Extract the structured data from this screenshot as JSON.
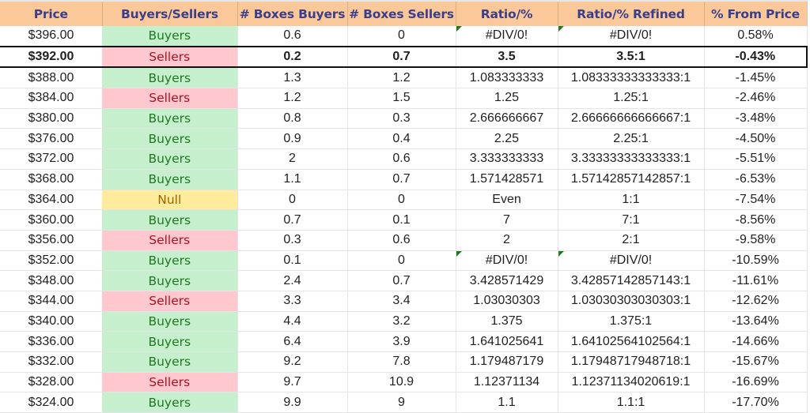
{
  "table": {
    "headers": [
      "Price",
      "Buyers/Sellers",
      "# Boxes Buyers",
      "# Boxes Sellers",
      "Ratio/%",
      "Ratio/% Refined",
      "% From Price"
    ],
    "rows": [
      {
        "price": "$396.00",
        "side": "Buyers",
        "boxes_buyers": "0.6",
        "boxes_sellers": "0",
        "ratio": "#DIV/0!",
        "ratio_refined": "#DIV/0!",
        "pct_from_price": "0.58%",
        "error_flag": true,
        "current": false
      },
      {
        "price": "$392.00",
        "side": "Sellers",
        "boxes_buyers": "0.2",
        "boxes_sellers": "0.7",
        "ratio": "3.5",
        "ratio_refined": "3.5:1",
        "pct_from_price": "-0.43%",
        "error_flag": false,
        "current": true
      },
      {
        "price": "$388.00",
        "side": "Buyers",
        "boxes_buyers": "1.3",
        "boxes_sellers": "1.2",
        "ratio": "1.083333333",
        "ratio_refined": "1.08333333333333:1",
        "pct_from_price": "-1.45%",
        "error_flag": false,
        "current": false
      },
      {
        "price": "$384.00",
        "side": "Sellers",
        "boxes_buyers": "1.2",
        "boxes_sellers": "1.5",
        "ratio": "1.25",
        "ratio_refined": "1.25:1",
        "pct_from_price": "-2.46%",
        "error_flag": false,
        "current": false
      },
      {
        "price": "$380.00",
        "side": "Buyers",
        "boxes_buyers": "0.8",
        "boxes_sellers": "0.3",
        "ratio": "2.666666667",
        "ratio_refined": "2.66666666666667:1",
        "pct_from_price": "-3.48%",
        "error_flag": false,
        "current": false
      },
      {
        "price": "$376.00",
        "side": "Buyers",
        "boxes_buyers": "0.9",
        "boxes_sellers": "0.4",
        "ratio": "2.25",
        "ratio_refined": "2.25:1",
        "pct_from_price": "-4.50%",
        "error_flag": false,
        "current": false
      },
      {
        "price": "$372.00",
        "side": "Buyers",
        "boxes_buyers": "2",
        "boxes_sellers": "0.6",
        "ratio": "3.333333333",
        "ratio_refined": "3.33333333333333:1",
        "pct_from_price": "-5.51%",
        "error_flag": false,
        "current": false
      },
      {
        "price": "$368.00",
        "side": "Buyers",
        "boxes_buyers": "1.1",
        "boxes_sellers": "0.7",
        "ratio": "1.571428571",
        "ratio_refined": "1.57142857142857:1",
        "pct_from_price": "-6.53%",
        "error_flag": false,
        "current": false
      },
      {
        "price": "$364.00",
        "side": "Null",
        "boxes_buyers": "0",
        "boxes_sellers": "0",
        "ratio": "Even",
        "ratio_refined": "1:1",
        "pct_from_price": "-7.54%",
        "error_flag": false,
        "current": false
      },
      {
        "price": "$360.00",
        "side": "Buyers",
        "boxes_buyers": "0.7",
        "boxes_sellers": "0.1",
        "ratio": "7",
        "ratio_refined": "7:1",
        "pct_from_price": "-8.56%",
        "error_flag": false,
        "current": false
      },
      {
        "price": "$356.00",
        "side": "Sellers",
        "boxes_buyers": "0.3",
        "boxes_sellers": "0.6",
        "ratio": "2",
        "ratio_refined": "2:1",
        "pct_from_price": "-9.58%",
        "error_flag": false,
        "current": false
      },
      {
        "price": "$352.00",
        "side": "Buyers",
        "boxes_buyers": "0.1",
        "boxes_sellers": "0",
        "ratio": "#DIV/0!",
        "ratio_refined": "#DIV/0!",
        "pct_from_price": "-10.59%",
        "error_flag": true,
        "current": false
      },
      {
        "price": "$348.00",
        "side": "Buyers",
        "boxes_buyers": "2.4",
        "boxes_sellers": "0.7",
        "ratio": "3.428571429",
        "ratio_refined": "3.42857142857143:1",
        "pct_from_price": "-11.61%",
        "error_flag": false,
        "current": false
      },
      {
        "price": "$344.00",
        "side": "Sellers",
        "boxes_buyers": "3.3",
        "boxes_sellers": "3.4",
        "ratio": "1.03030303",
        "ratio_refined": "1.03030303030303:1",
        "pct_from_price": "-12.62%",
        "error_flag": false,
        "current": false
      },
      {
        "price": "$340.00",
        "side": "Buyers",
        "boxes_buyers": "4.4",
        "boxes_sellers": "3.2",
        "ratio": "1.375",
        "ratio_refined": "1.375:1",
        "pct_from_price": "-13.64%",
        "error_flag": false,
        "current": false
      },
      {
        "price": "$336.00",
        "side": "Buyers",
        "boxes_buyers": "6.4",
        "boxes_sellers": "3.9",
        "ratio": "1.641025641",
        "ratio_refined": "1.64102564102564:1",
        "pct_from_price": "-14.66%",
        "error_flag": false,
        "current": false
      },
      {
        "price": "$332.00",
        "side": "Buyers",
        "boxes_buyers": "9.2",
        "boxes_sellers": "7.8",
        "ratio": "1.179487179",
        "ratio_refined": "1.17948717948718:1",
        "pct_from_price": "-15.67%",
        "error_flag": false,
        "current": false
      },
      {
        "price": "$328.00",
        "side": "Sellers",
        "boxes_buyers": "9.7",
        "boxes_sellers": "10.9",
        "ratio": "1.12371134",
        "ratio_refined": "1.12371134020619:1",
        "pct_from_price": "-16.69%",
        "error_flag": false,
        "current": false
      },
      {
        "price": "$324.00",
        "side": "Buyers",
        "boxes_buyers": "9.9",
        "boxes_sellers": "9",
        "ratio": "1.1",
        "ratio_refined": "1.1:1",
        "pct_from_price": "-17.70%",
        "error_flag": false,
        "current": false
      }
    ]
  },
  "colors": {
    "header_bg": "#fbc89a",
    "header_text": "#3b3f8a",
    "buyers_bg": "#c6efce",
    "buyers_text": "#1e7a1e",
    "sellers_bg": "#ffc7ce",
    "sellers_text": "#b0121f",
    "null_bg": "#ffeb9c",
    "null_text": "#9c6500",
    "error_flag": "#1f7a1f"
  }
}
